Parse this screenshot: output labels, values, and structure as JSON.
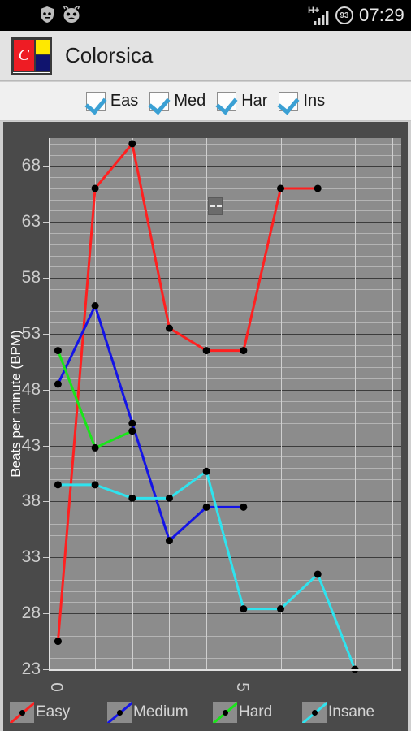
{
  "statusbar": {
    "icons": [
      "privacy-guard-icon",
      "cyanogenmod-icon"
    ],
    "network_type": "H+",
    "signal_icon": "signal-bars-icon",
    "battery_level": "93",
    "clock": "07:29"
  },
  "actionbar": {
    "app_icon_letter": "C",
    "title": "Colorsica",
    "icon_colors": {
      "red": "#ee1c24",
      "yellow": "#ffe800",
      "blue": "#10146e",
      "white": "#ffffff"
    }
  },
  "filters": [
    {
      "label": "Eas",
      "checked": true
    },
    {
      "label": "Med",
      "checked": true
    },
    {
      "label": "Har",
      "checked": true
    },
    {
      "label": "Ins",
      "checked": true
    }
  ],
  "chart_data": {
    "type": "line",
    "title": "",
    "xlabel": "",
    "ylabel": "Beats per minute (BPM)",
    "ylim": [
      23,
      70.5
    ],
    "xlim": [
      -0.25,
      9.25
    ],
    "yticks": [
      68,
      63,
      58,
      53,
      48,
      43,
      38,
      33,
      28,
      23
    ],
    "xticks": [
      0,
      5
    ],
    "xticklabels": [
      "0",
      "5"
    ],
    "grid": true,
    "legend_position": "bottom",
    "series": [
      {
        "name": "Easy",
        "color": "#ff2020",
        "x": [
          0,
          1,
          2,
          3,
          4,
          5,
          6,
          7
        ],
        "values": [
          25.5,
          66,
          70,
          53.5,
          51.5,
          51.5,
          66,
          66
        ]
      },
      {
        "name": "Medium",
        "color": "#1414e6",
        "x": [
          0,
          1,
          2,
          3,
          4,
          5
        ],
        "values": [
          48.5,
          55.5,
          45,
          34.5,
          37.5,
          37.5
        ]
      },
      {
        "name": "Hard",
        "color": "#19e619",
        "x": [
          0,
          1,
          2
        ],
        "values": [
          51.5,
          42.8,
          44.3
        ]
      },
      {
        "name": "Insane",
        "color": "#2fe3ee",
        "x": [
          0,
          1,
          2,
          3,
          4,
          5,
          6,
          7,
          8
        ],
        "values": [
          39.5,
          39.5,
          38.3,
          38.3,
          40.7,
          28.4,
          28.4,
          31.5,
          23
        ]
      }
    ]
  },
  "legend": [
    {
      "label": "Easy",
      "color": "#ff2020"
    },
    {
      "label": "Medium",
      "color": "#1414e6"
    },
    {
      "label": "Hard",
      "color": "#19e619"
    },
    {
      "label": "Insane",
      "color": "#2fe3ee"
    }
  ],
  "pan_widget": {
    "name": "pan-handle"
  }
}
